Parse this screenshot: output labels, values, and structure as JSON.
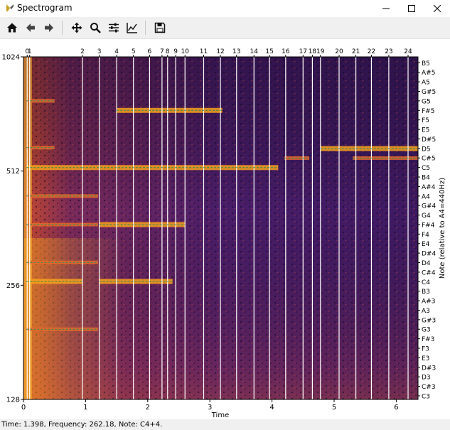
{
  "window": {
    "title": "Spectrogram",
    "minimize_icon": "minimize-icon",
    "maximize_icon": "maximize-icon",
    "close_icon": "close-icon"
  },
  "toolbar": {
    "buttons": [
      {
        "name": "home-button",
        "icon": "home-icon"
      },
      {
        "name": "back-button",
        "icon": "arrow-left-icon"
      },
      {
        "name": "forward-button",
        "icon": "arrow-right-icon"
      },
      {
        "name": "pan-button",
        "icon": "move-icon"
      },
      {
        "name": "zoom-button",
        "icon": "magnifier-icon"
      },
      {
        "name": "configure-subplots-button",
        "icon": "sliders-icon"
      },
      {
        "name": "edit-axis-button",
        "icon": "line-chart-icon"
      },
      {
        "name": "save-button",
        "icon": "floppy-disk-icon"
      }
    ]
  },
  "status": {
    "text": "Time: 1.398, Frequency: 262.18, Note: C4+4."
  },
  "colors": {
    "accent_line": "#ffffff",
    "pitch_trace": "#2e8b57",
    "colormap": "inferno"
  },
  "chart_data": {
    "type": "heatmap",
    "xlabel": "Time",
    "ylabel_right": "Note (relative to A4=440Hz)",
    "xlim": [
      0,
      6.35
    ],
    "ylim_log2": [
      128,
      1024
    ],
    "x_ticks": [
      0,
      1,
      2,
      3,
      4,
      5,
      6
    ],
    "y_ticks_left": [
      128,
      256,
      512,
      1024
    ],
    "note_labels": [
      "C3",
      "C#3",
      "D3",
      "D#3",
      "E3",
      "F3",
      "F#3",
      "G3",
      "G#3",
      "A3",
      "A#3",
      "B3",
      "C4",
      "C#4",
      "D4",
      "D#4",
      "E4",
      "F4",
      "F#4",
      "G4",
      "G#4",
      "A4",
      "A#4",
      "B4",
      "C5",
      "C#5",
      "D5",
      "D#5",
      "E5",
      "F5",
      "F#5",
      "G5",
      "G#5",
      "A5",
      "A#5",
      "B5"
    ],
    "onset_labels": [
      "0",
      "1",
      "2",
      "3",
      "4",
      "5",
      "6",
      "7",
      "8",
      "9",
      "10",
      "11",
      "12",
      "13",
      "14",
      "15",
      "16",
      "17",
      "18",
      "19",
      "20",
      "21",
      "22",
      "23",
      "24"
    ],
    "onset_times": [
      0.06,
      0.1,
      0.95,
      1.22,
      1.5,
      1.77,
      2.03,
      2.23,
      2.32,
      2.45,
      2.6,
      2.9,
      3.17,
      3.43,
      3.71,
      3.96,
      4.22,
      4.5,
      4.65,
      4.78,
      5.08,
      5.35,
      5.6,
      5.88,
      6.19
    ],
    "pitch_segments": [
      {
        "t0": 0.05,
        "t1": 0.95,
        "f": 523,
        "level": "high"
      },
      {
        "t0": 0.05,
        "t1": 0.95,
        "f": 262,
        "level": "high"
      },
      {
        "t0": 0.05,
        "t1": 1.2,
        "f": 440,
        "level": "mid"
      },
      {
        "t0": 0.05,
        "t1": 1.2,
        "f": 196,
        "level": "mid"
      },
      {
        "t0": 0.05,
        "t1": 1.2,
        "f": 294,
        "level": "mid"
      },
      {
        "t0": 0.05,
        "t1": 1.2,
        "f": 370,
        "level": "mid"
      },
      {
        "t0": 0.05,
        "t1": 0.5,
        "f": 590,
        "level": "mid"
      },
      {
        "t0": 0.05,
        "t1": 0.5,
        "f": 784,
        "level": "mid"
      },
      {
        "t0": 0.95,
        "t1": 4.1,
        "f": 523,
        "level": "high"
      },
      {
        "t0": 1.22,
        "t1": 2.6,
        "f": 370,
        "level": "high"
      },
      {
        "t0": 1.22,
        "t1": 2.4,
        "f": 262,
        "level": "high"
      },
      {
        "t0": 1.5,
        "t1": 3.2,
        "f": 740,
        "level": "high"
      },
      {
        "t0": 4.2,
        "t1": 4.6,
        "f": 554,
        "level": "mid"
      },
      {
        "t0": 4.78,
        "t1": 6.35,
        "f": 587,
        "level": "high"
      },
      {
        "t0": 5.3,
        "t1": 6.35,
        "f": 554,
        "level": "mid"
      }
    ]
  }
}
